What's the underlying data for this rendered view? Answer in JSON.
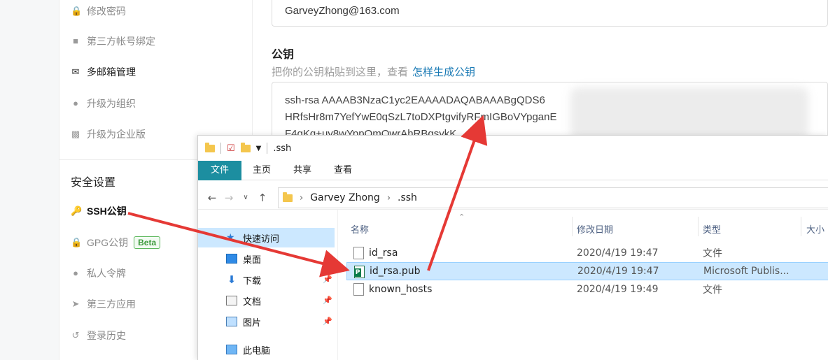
{
  "sidebar": {
    "items": [
      {
        "label": "修改密码",
        "icon": "lock-icon"
      },
      {
        "label": "第三方帐号绑定",
        "icon": "user-icon"
      },
      {
        "label": "多邮箱管理",
        "icon": "envelope-icon"
      },
      {
        "label": "升级为组织",
        "icon": "users-icon"
      },
      {
        "label": "升级为企业版",
        "icon": "building-icon"
      }
    ],
    "security_title": "安全设置",
    "security_items": [
      {
        "label": "SSH公钥",
        "icon": "key-icon"
      },
      {
        "label": "GPG公钥",
        "icon": "lock-icon",
        "badge": "Beta"
      },
      {
        "label": "私人令牌",
        "icon": "people-icon"
      },
      {
        "label": "第三方应用",
        "icon": "rocket-icon"
      },
      {
        "label": "登录历史",
        "icon": "history-icon"
      }
    ]
  },
  "main": {
    "email_value": "GarveyZhong@163.com",
    "pubkey_title": "公钥",
    "pubkey_hint": "把你的公钥粘贴到这里，查看",
    "pubkey_link": "怎样生成公钥",
    "pubkey_lines": [
      "ssh-rsa AAAAB3NzaC1yc2EAAAADAQABAAABgQDS6",
      "HRfsHr8m7YefYwE0qSzL7toDXPtgvifyRFmIGBoVYpganE",
      "F4qKq+uy8wYppQmQwrAhRBqsykK"
    ]
  },
  "explorer": {
    "title": ".ssh",
    "ribbon_tabs": [
      "文件",
      "主页",
      "共享",
      "查看"
    ],
    "path": [
      "Garvey Zhong",
      ".ssh"
    ],
    "nav": [
      {
        "label": "快速访问",
        "icon": "star-icon"
      },
      {
        "label": "桌面",
        "icon": "desktop-icon"
      },
      {
        "label": "下载",
        "icon": "download-icon"
      },
      {
        "label": "文档",
        "icon": "document-icon"
      },
      {
        "label": "图片",
        "icon": "picture-icon"
      },
      {
        "label": "此电脑",
        "icon": "computer-icon"
      }
    ],
    "columns": [
      "名称",
      "修改日期",
      "类型",
      "大小"
    ],
    "files": [
      {
        "name": "id_rsa",
        "date": "2020/4/19 19:47",
        "type": "文件"
      },
      {
        "name": "id_rsa.pub",
        "date": "2020/4/19 19:47",
        "type": "Microsoft Publis..."
      },
      {
        "name": "known_hosts",
        "date": "2020/4/19 19:49",
        "type": "文件"
      }
    ]
  },
  "colors": {
    "accent": "#1c8ea0",
    "link": "#1a7ab5",
    "arrow": "#e53935",
    "selection": "#cce8ff"
  }
}
